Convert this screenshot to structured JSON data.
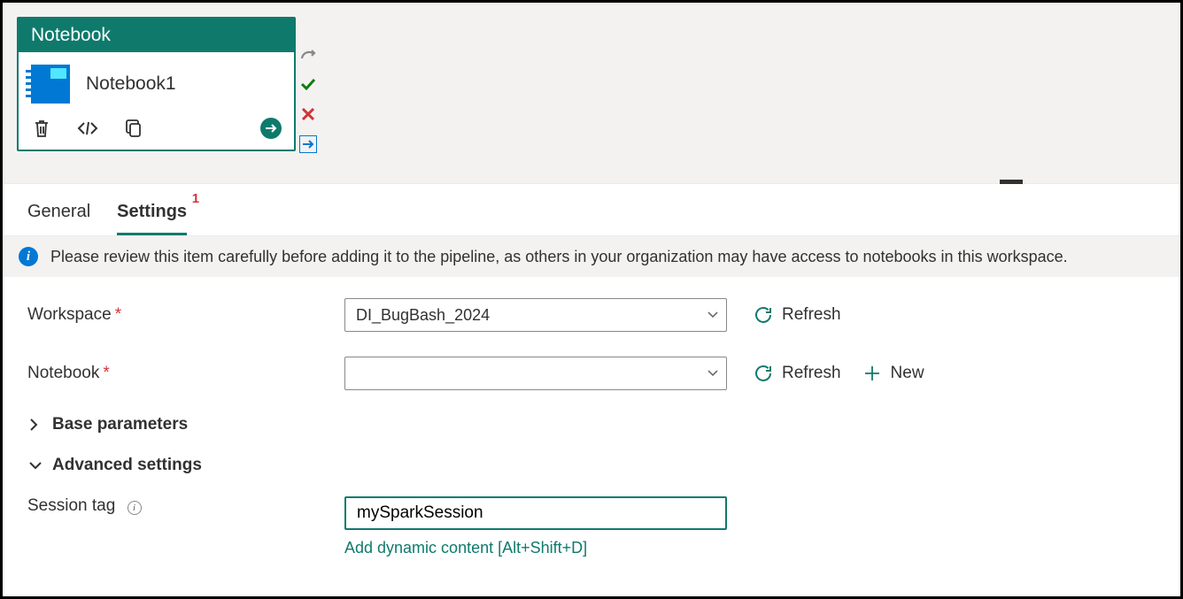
{
  "activity": {
    "type_label": "Notebook",
    "name": "Notebook1"
  },
  "tabs": {
    "general": "General",
    "settings": "Settings",
    "settings_badge": "1"
  },
  "info_message": "Please review this item carefully before adding it to the pipeline, as others in your organization may have access to notebooks in this workspace.",
  "form": {
    "workspace_label": "Workspace",
    "workspace_value": "DI_BugBash_2024",
    "notebook_label": "Notebook",
    "notebook_value": "",
    "refresh_label": "Refresh",
    "new_label": "New",
    "base_params_label": "Base parameters",
    "advanced_label": "Advanced settings",
    "session_tag_label": "Session tag",
    "session_tag_value": "mySparkSession",
    "dynamic_link": "Add dynamic content [Alt+Shift+D]"
  }
}
